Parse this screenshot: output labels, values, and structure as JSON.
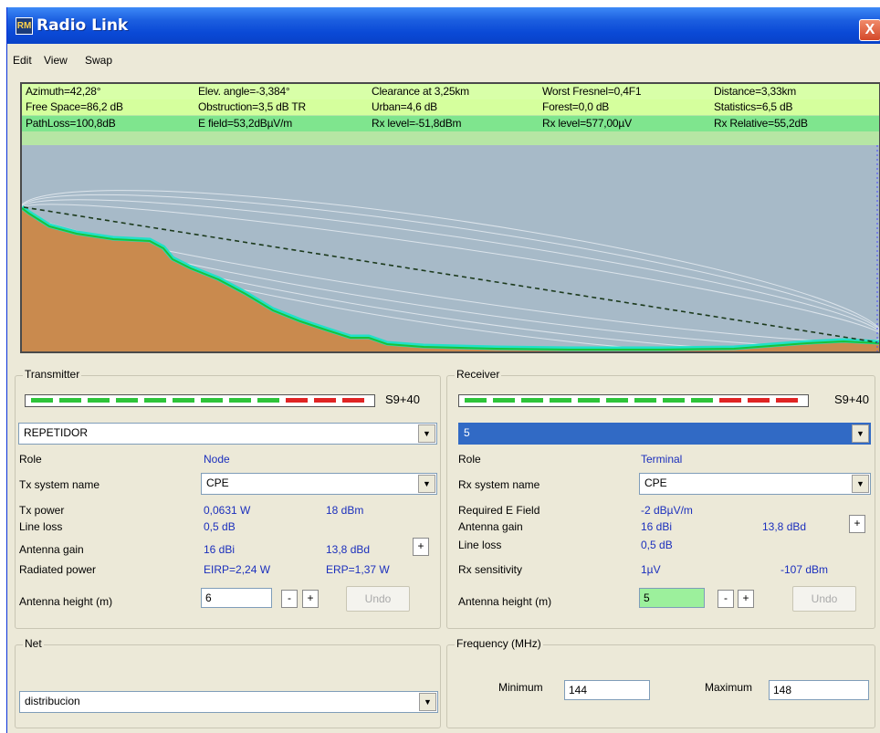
{
  "window": {
    "title": "Radio Link",
    "close_glyph": "X"
  },
  "menu": [
    "Edit",
    "View",
    "Swap"
  ],
  "info": {
    "row1": [
      "Azimuth=42,28°",
      "Elev. angle=-3,384°",
      "Clearance at 3,25km",
      "Worst Fresnel=0,4F1",
      "Distance=3,33km"
    ],
    "row2": [
      "Free Space=86,2 dB",
      "Obstruction=3,5 dB TR",
      "Urban=4,6 dB",
      "Forest=0,0 dB",
      "Statistics=6,5 dB"
    ],
    "row3": [
      "PathLoss=100,8dB",
      "E field=53,2dBµV/m",
      "Rx level=-51,8dBm",
      "Rx level=577,00µV",
      "Rx Relative=55,2dB"
    ]
  },
  "transmitter": {
    "legend": "Transmitter",
    "signal_text": "S9+40",
    "signal_level_segments": 9,
    "signal_total_segments": 12,
    "station": "REPETIDOR",
    "role_label": "Role",
    "role_value": "Node",
    "system_label": "Tx system name",
    "system_value": "CPE",
    "power_label": "Tx power",
    "power_w": "0,0631 W",
    "power_dbm": "18 dBm",
    "lineloss_label": "Line loss",
    "lineloss_value": "0,5 dB",
    "gain_label": "Antenna gain",
    "gain_dbi": "16 dBi",
    "gain_dbd": "13,8 dBd",
    "radiated_label": "Radiated power",
    "eirp": "EIRP=2,24 W",
    "erp": "ERP=1,37 W",
    "height_label": "Antenna height (m)",
    "height_value": "6",
    "minus": "-",
    "plus": "+",
    "undo": "Undo"
  },
  "receiver": {
    "legend": "Receiver",
    "signal_text": "S9+40",
    "signal_level_segments": 9,
    "signal_total_segments": 12,
    "station": "5",
    "role_label": "Role",
    "role_value": "Terminal",
    "system_label": "Rx system name",
    "system_value": "CPE",
    "efield_label": "Required E Field",
    "efield_value": "-2 dBµV/m",
    "gain_label": "Antenna gain",
    "gain_dbi": "16 dBi",
    "gain_dbd": "13,8 dBd",
    "lineloss_label": "Line loss",
    "lineloss_value": "0,5 dB",
    "sens_label": "Rx sensitivity",
    "sens_uv": "1µV",
    "sens_dbm": "-107 dBm",
    "height_label": "Antenna height (m)",
    "height_value": "5",
    "minus": "-",
    "plus": "+",
    "undo": "Undo"
  },
  "net": {
    "legend": "Net",
    "value": "distribucion"
  },
  "frequency": {
    "legend": "Frequency (MHz)",
    "min_label": "Minimum",
    "min_value": "144",
    "max_label": "Maximum",
    "max_value": "148"
  },
  "colors": {
    "signal_green": "#2ec43a",
    "signal_red": "#e02424",
    "terrain": "#c98a4e",
    "sky": "#a7bac8",
    "profile_edge": "#22e0c8"
  }
}
